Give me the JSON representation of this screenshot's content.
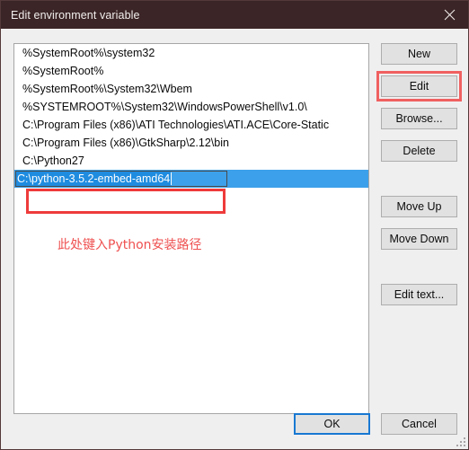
{
  "window": {
    "title": "Edit environment variable",
    "close_icon": "close-icon",
    "titlebar_color": "#3b2526"
  },
  "list": {
    "items": [
      {
        "text": "%SystemRoot%\\system32",
        "selected": false
      },
      {
        "text": "%SystemRoot%",
        "selected": false
      },
      {
        "text": "%SystemRoot%\\System32\\Wbem",
        "selected": false
      },
      {
        "text": "%SYSTEMROOT%\\System32\\WindowsPowerShell\\v1.0\\",
        "selected": false
      },
      {
        "text": "C:\\Program Files (x86)\\ATI Technologies\\ATI.ACE\\Core-Static",
        "selected": false
      },
      {
        "text": "C:\\Program Files (x86)\\GtkSharp\\2.12\\bin",
        "selected": false
      },
      {
        "text": "C:\\Python27",
        "selected": false
      },
      {
        "text": "C:\\python-3.5.2-embed-amd64",
        "selected": true
      }
    ],
    "editing_value": "C:\\python-3.5.2-embed-amd64",
    "selection_color": "#3da0ea"
  },
  "annotations": {
    "note_text": "此处键入Python安装路径",
    "note_color": "#ef5050",
    "rect_color": "#ef3b3b"
  },
  "buttons": {
    "new": "New",
    "edit": "Edit",
    "browse": "Browse...",
    "delete": "Delete",
    "move_up": "Move Up",
    "move_down": "Move Down",
    "edit_text": "Edit text...",
    "ok": "OK",
    "cancel": "Cancel"
  }
}
